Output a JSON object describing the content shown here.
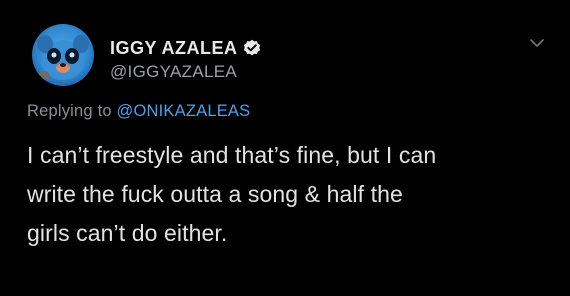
{
  "author": {
    "display_name": "IGGY AZALEA",
    "handle": "@IGGYAZALEA",
    "verified_icon": "verified-badge-icon",
    "avatar_icon": "avatar-icon"
  },
  "reply": {
    "prefix": "Replying to",
    "target": "@ONIKAZALEAS"
  },
  "tweet": {
    "lines": [
      "I can’t freestyle and that’s fine, but I can",
      "write the fuck outta a song & half the",
      "girls can’t do either."
    ]
  },
  "menu_icon": "chevron-down-icon",
  "colors": {
    "background": "#000000",
    "text": "#e2e2e2",
    "secondary_text": "#9aa0a6",
    "link": "#4aa1eb"
  }
}
